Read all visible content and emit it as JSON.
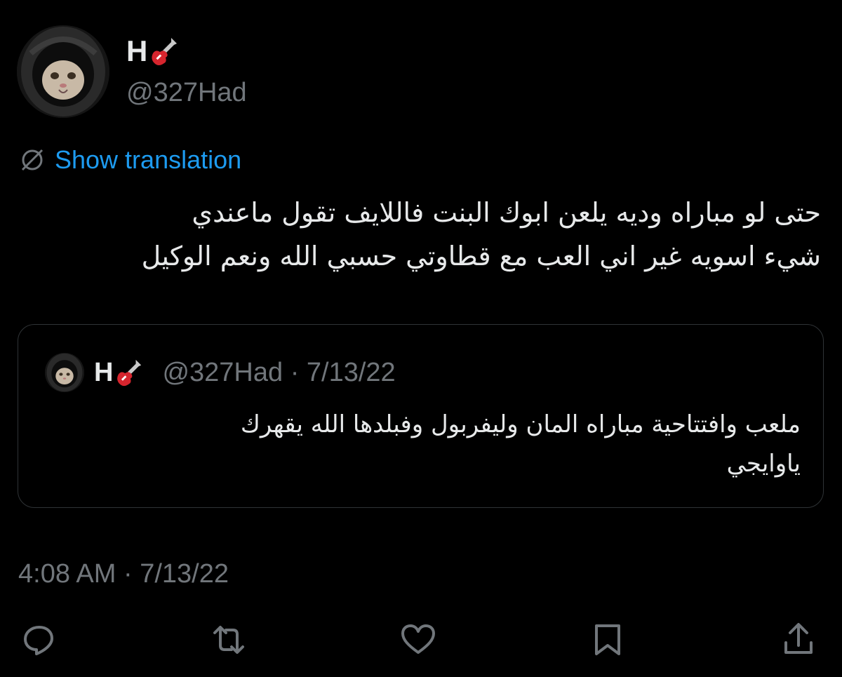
{
  "author": {
    "display_name": "H",
    "name_emoji": "guitar",
    "handle": "@327Had",
    "avatar": "cat-in-helmet-avatar"
  },
  "translation": {
    "label": "Show translation",
    "icon": "globe-icon"
  },
  "tweet": {
    "line1": "حتى لو مباراه وديه يلعن ابوك البنت فاللايف تقول ماعندي",
    "line2": "شيء اسويه غير اني العب مع قطاوتي حسبي الله ونعم الوكيل"
  },
  "quoted": {
    "display_name": "H",
    "name_emoji": "guitar",
    "meta": "@327Had · 7/13/22",
    "line1": "ملعب وافتتاحية مباراه المان وليفربول وفبلدها الله يقهرك",
    "line2": "ياوايجي"
  },
  "timestamp": "4:08 AM · 7/13/22",
  "actions": [
    {
      "name": "reply",
      "icon": "reply-icon"
    },
    {
      "name": "retweet",
      "icon": "retweet-icon"
    },
    {
      "name": "like",
      "icon": "heart-icon"
    },
    {
      "name": "bookmark",
      "icon": "bookmark-icon"
    },
    {
      "name": "share",
      "icon": "share-icon"
    }
  ],
  "colors": {
    "background": "#000000",
    "text": "#e7e9ea",
    "secondary": "#71767b",
    "link": "#1d9bf0",
    "border": "#2f3336"
  }
}
